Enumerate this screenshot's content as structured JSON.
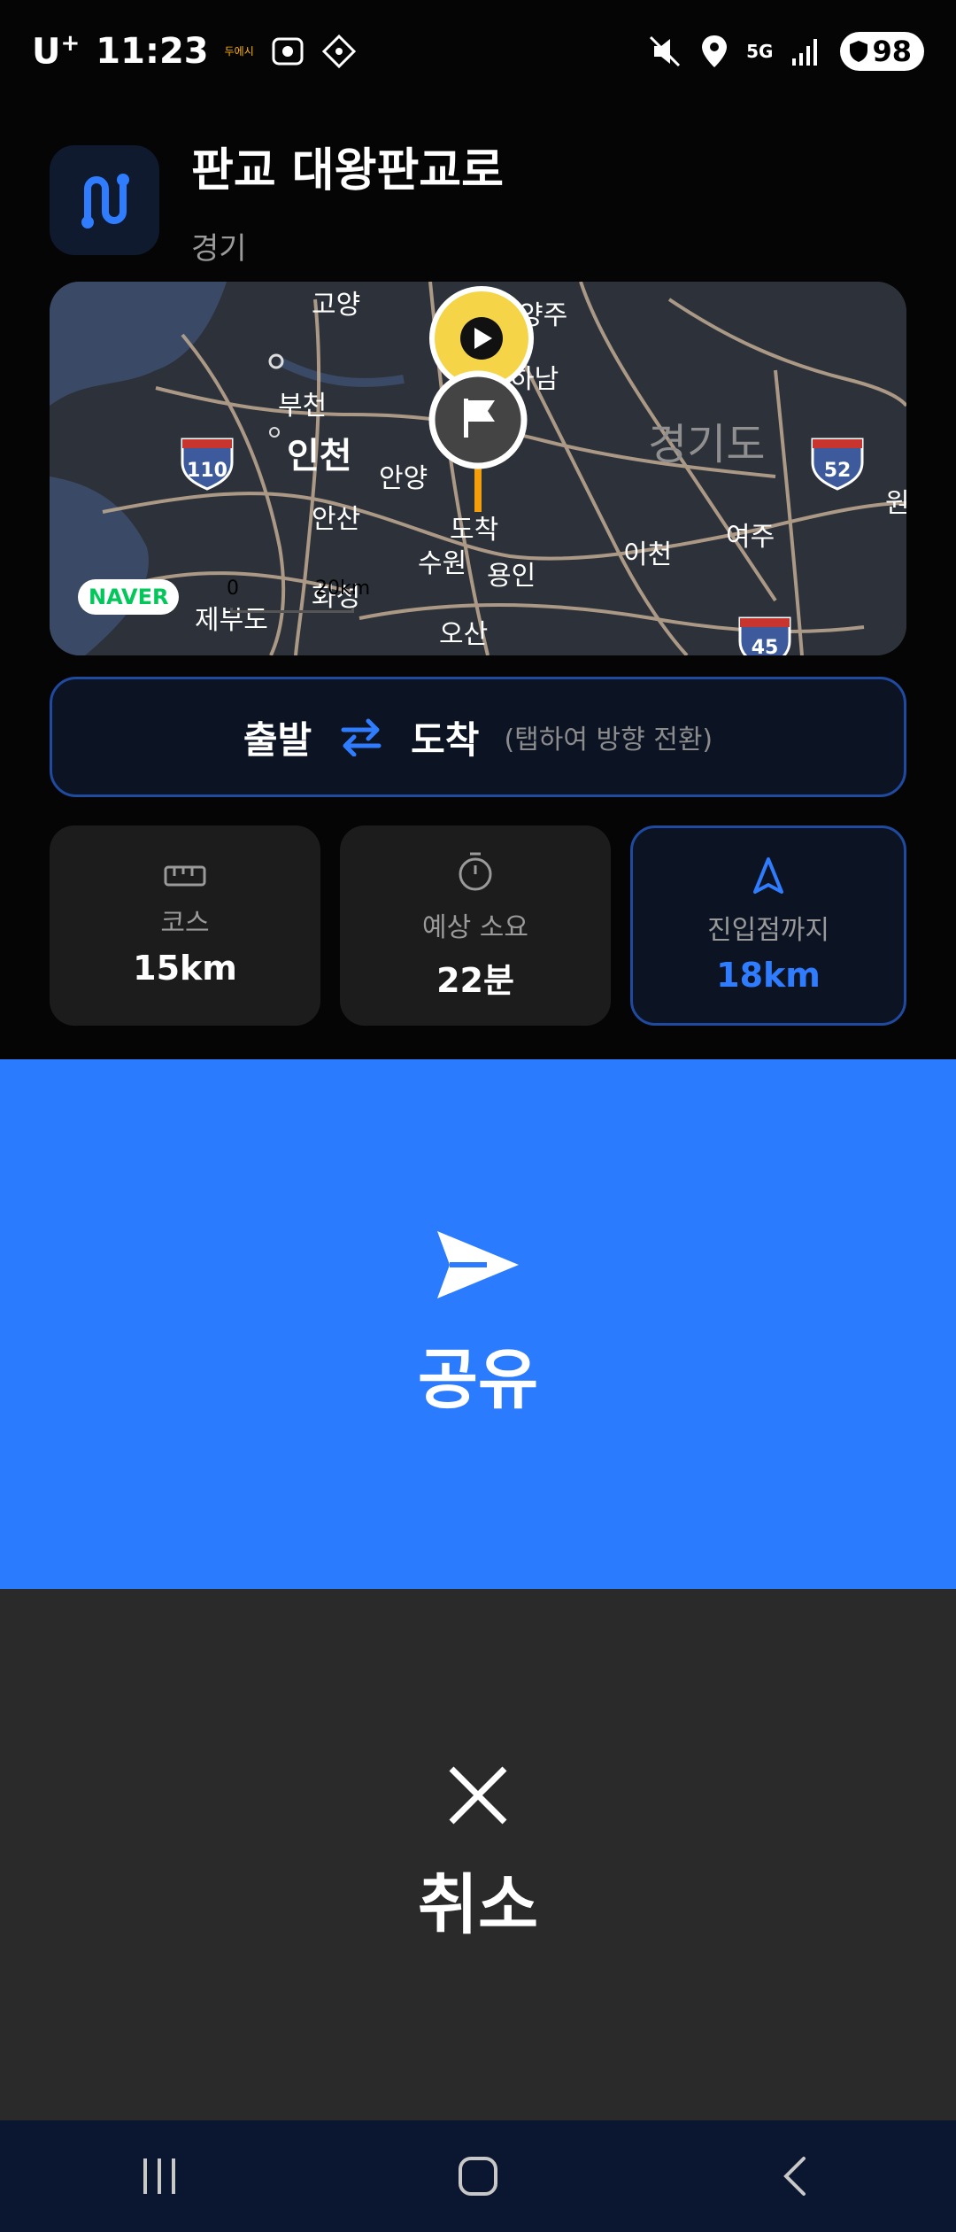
{
  "status_bar": {
    "carrier": "U",
    "carrier_sup": "+",
    "time": "11:23",
    "small_badge": "두에시",
    "network": "5G",
    "battery": "98"
  },
  "header": {
    "title": "판교 대왕판교로",
    "region": "경기"
  },
  "map": {
    "labels": [
      "고양",
      "양주",
      "하남",
      "부천",
      "인천",
      "안양",
      "경기도",
      "안산",
      "도착",
      "수원",
      "용인",
      "이천",
      "여주",
      "화성",
      "제부도",
      "오산",
      "원"
    ],
    "highways": [
      "110",
      "52",
      "45"
    ],
    "naver_badge": "NAVER",
    "scale_zero": "0",
    "scale_distance": "20km"
  },
  "direction": {
    "from": "출발",
    "to": "도착",
    "hint": "(탭하여 방향 전환)"
  },
  "stats": [
    {
      "label": "코스",
      "value": "15km",
      "icon": "ruler-icon"
    },
    {
      "label": "예상 소요",
      "value": "22분",
      "icon": "stopwatch-icon"
    },
    {
      "label": "진입점까지",
      "value": "18km",
      "icon": "navigation-arrow-icon"
    }
  ],
  "actions": {
    "share_label": "공유",
    "cancel_label": "취소"
  },
  "colors": {
    "accent": "#2b7bff",
    "start_marker": "#f5d547",
    "cancel_bg": "#2a2a2a"
  }
}
